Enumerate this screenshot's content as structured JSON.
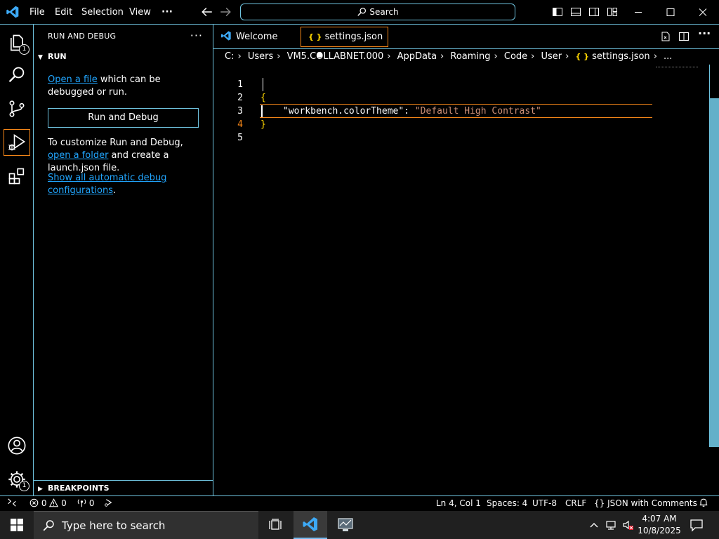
{
  "titlebar": {
    "menu": [
      "File",
      "Edit",
      "Selection",
      "View"
    ],
    "more": "···",
    "search_label": "Search"
  },
  "activitybar": {
    "explorer_badge": "1",
    "manage_badge": "1"
  },
  "sidebar": {
    "title": "RUN AND DEBUG",
    "more": "···",
    "run_section": "RUN",
    "open_file_link": "Open a file",
    "open_file_rest": " which can be debugged or run.",
    "run_button": "Run and Debug",
    "customize_pre": "To customize Run and Debug, ",
    "open_folder_link": "open a folder",
    "customize_post": " and create a launch.json file.",
    "show_all_link": "Show all automatic debug configurations",
    "show_all_post": ".",
    "breakpoints_section": "BREAKPOINTS"
  },
  "tabs": [
    {
      "label": "Welcome",
      "active": false
    },
    {
      "label": "settings.json",
      "active": true,
      "dirty": true
    }
  ],
  "breadcrumb": {
    "parts": [
      "C:",
      "Users",
      "VM5.COLLABNET.000",
      "AppData",
      "Roaming",
      "Code",
      "User"
    ],
    "file": "settings.json",
    "tail": "..."
  },
  "editor": {
    "lines": [
      {
        "n": "1",
        "text": "{"
      },
      {
        "n": "2",
        "key": "\"workbench.colorTheme\"",
        "colon": ": ",
        "value": "\"Default High Contrast\""
      },
      {
        "n": "3",
        "text": "}"
      },
      {
        "n": "4",
        "text": ""
      },
      {
        "n": "5",
        "text": ""
      }
    ],
    "current_line": 4
  },
  "statusbar": {
    "errors": "0",
    "warnings": "0",
    "ports": "0",
    "position": "Ln 4, Col 1",
    "spaces": "Spaces: 4",
    "encoding": "UTF-8",
    "eol": "CRLF",
    "language": "JSON with Comments",
    "language_icon": "{}"
  },
  "taskbar": {
    "search_placeholder": "Type here to search",
    "time": "4:07 AM",
    "date": "10/8/2025"
  },
  "colors": {
    "border": "#6fc3df",
    "active_border": "#f38518",
    "link": "#21a6ff",
    "string": "#ce9178",
    "brace": "#ffd700"
  }
}
